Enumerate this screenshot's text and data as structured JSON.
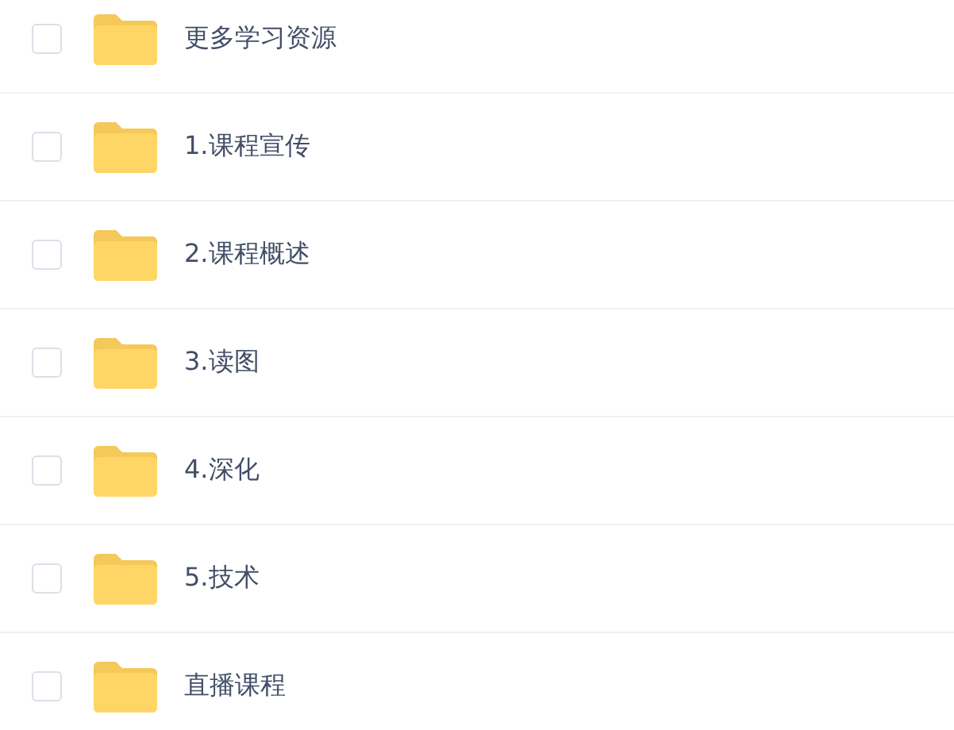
{
  "items": [
    {
      "name": "更多学习资源",
      "checked": false
    },
    {
      "name": "1.课程宣传",
      "checked": false
    },
    {
      "name": "2.课程概述",
      "checked": false
    },
    {
      "name": "3.读图",
      "checked": false
    },
    {
      "name": "4.深化",
      "checked": false
    },
    {
      "name": "5.技术",
      "checked": false
    },
    {
      "name": "直播课程",
      "checked": false
    }
  ]
}
